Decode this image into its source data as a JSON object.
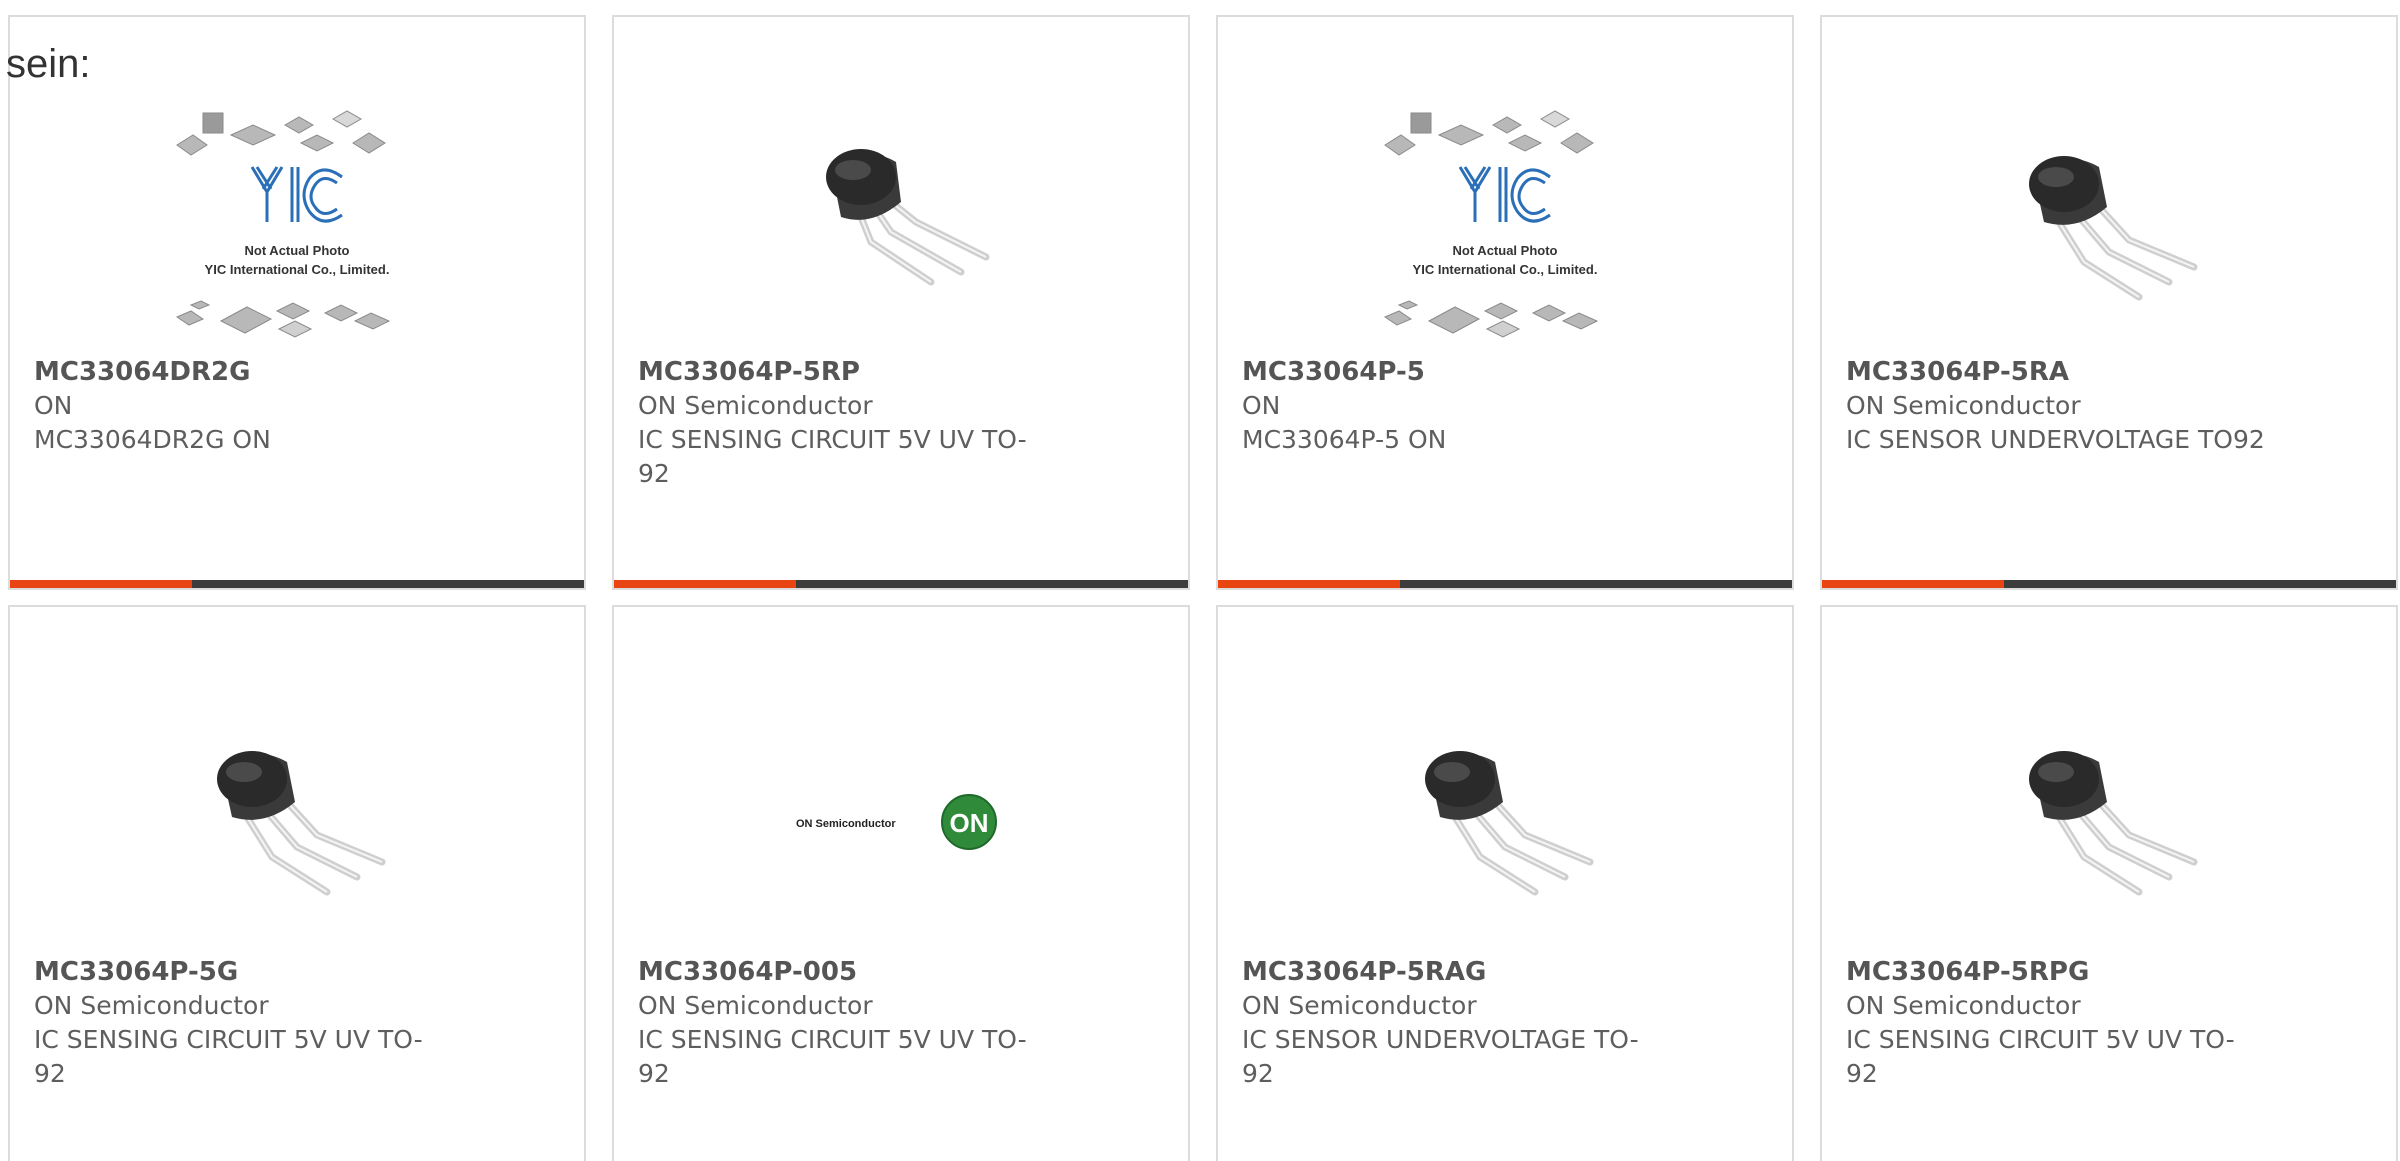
{
  "intro": "sein:",
  "colors": {
    "accent": "#e94512",
    "bar": "#3c3c3c",
    "card_border": "#dcdcdc",
    "text": "#5e5e5e",
    "transistor_body": "#3a3a3a",
    "transistor_leads": "#cfcfcf",
    "yic_blue": "#2a6fb8",
    "on_green": "#2f8a3a"
  },
  "placeholder_image": {
    "logo": "YIC",
    "line1": "Not Actual Photo",
    "line2": "YIC International Co., Limited."
  },
  "on_logo": {
    "wordmark": "ON Semiconductor",
    "badge": "ON"
  },
  "products": [
    {
      "part": "MC33064DR2G",
      "maker": "ON",
      "desc": "MC33064DR2G ON",
      "image": "yic-placeholder-image"
    },
    {
      "part": "MC33064P-5RP",
      "maker": "ON Semiconductor",
      "desc": "IC SENSING CIRCUIT 5V UV TO-92",
      "image": "to92-transistor-image"
    },
    {
      "part": "MC33064P-5",
      "maker": "ON",
      "desc": "MC33064P-5 ON",
      "image": "yic-placeholder-image"
    },
    {
      "part": "MC33064P-5RA",
      "maker": "ON Semiconductor",
      "desc": "IC SENSOR UNDERVOLTAGE TO92",
      "image": "to92-transistor-image"
    },
    {
      "part": "MC33064P-5G",
      "maker": "ON Semiconductor",
      "desc": "IC SENSING CIRCUIT 5V UV TO-92",
      "image": "to92-transistor-image"
    },
    {
      "part": "MC33064P-005",
      "maker": "ON Semiconductor",
      "desc": "IC SENSING CIRCUIT 5V UV TO-92",
      "image": "on-semiconductor-logo-image"
    },
    {
      "part": "MC33064P-5RAG",
      "maker": "ON Semiconductor",
      "desc": "IC SENSOR UNDERVOLTAGE TO-92",
      "image": "to92-transistor-image"
    },
    {
      "part": "MC33064P-5RPG",
      "maker": "ON Semiconductor",
      "desc": "IC SENSING CIRCUIT 5V UV TO-92",
      "image": "to92-transistor-image"
    }
  ]
}
